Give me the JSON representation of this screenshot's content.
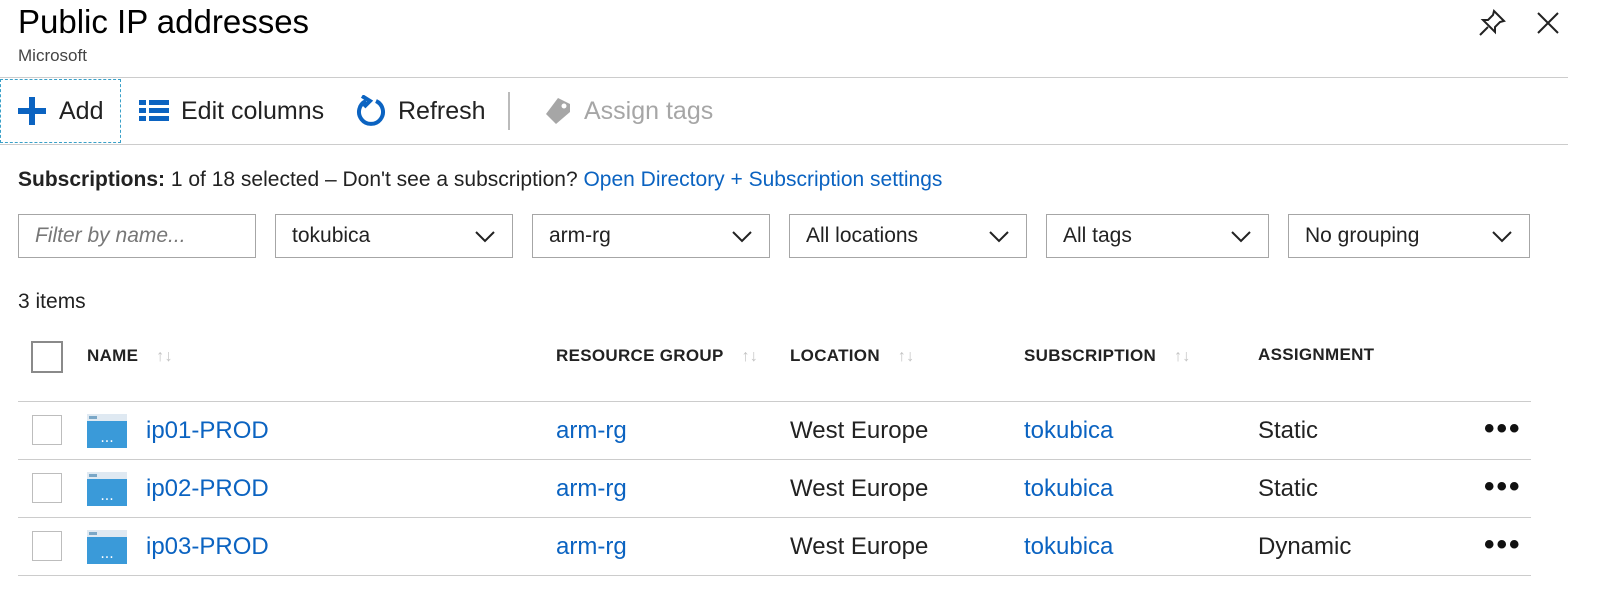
{
  "page": {
    "title": "Public IP addresses",
    "subtitle": "Microsoft"
  },
  "toolbar": {
    "add": "Add",
    "edit_columns": "Edit columns",
    "refresh": "Refresh",
    "assign_tags": "Assign tags"
  },
  "subscriptions": {
    "label": "Subscriptions:",
    "text": "1 of 18 selected – Don't see a subscription?",
    "link": "Open Directory + Subscription settings"
  },
  "filters": {
    "name_placeholder": "Filter by name...",
    "subscription": "tokubica",
    "resource_group": "arm-rg",
    "locations": "All locations",
    "tags": "All tags",
    "grouping": "No grouping"
  },
  "count": "3 items",
  "columns": [
    "NAME",
    "RESOURCE GROUP",
    "LOCATION",
    "SUBSCRIPTION",
    "ASSIGNMENT"
  ],
  "rows": [
    {
      "name": "ip01-PROD",
      "resource_group": "arm-rg",
      "location": "West Europe",
      "subscription": "tokubica",
      "assignment": "Static"
    },
    {
      "name": "ip02-PROD",
      "resource_group": "arm-rg",
      "location": "West Europe",
      "subscription": "tokubica",
      "assignment": "Static"
    },
    {
      "name": "ip03-PROD",
      "resource_group": "arm-rg",
      "location": "West Europe",
      "subscription": "tokubica",
      "assignment": "Dynamic"
    }
  ],
  "more_label": "•••",
  "sort_glyph": "↑↓",
  "colors": {
    "accent": "#0b63c1",
    "icon_blue": "#3a9ad9"
  }
}
